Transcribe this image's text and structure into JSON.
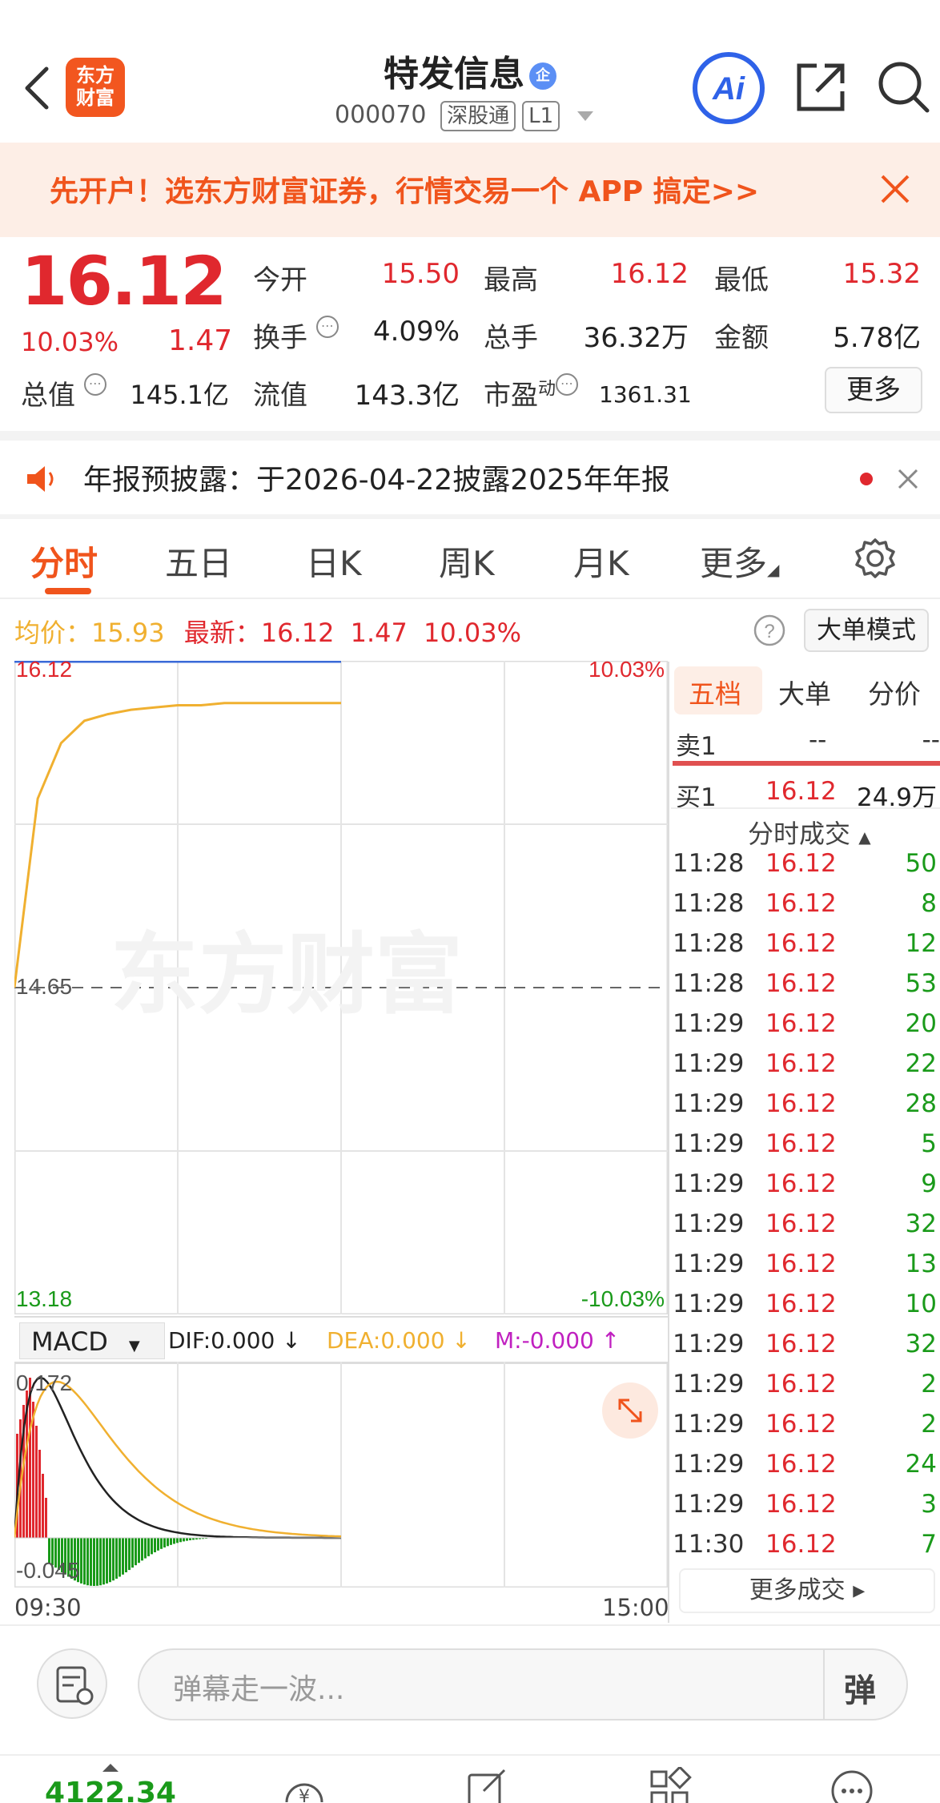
{
  "header": {
    "logo_text_1": "东方",
    "logo_text_2": "财富",
    "stock_name": "特发信息",
    "badge": "企",
    "code": "000070",
    "tag_market": "深股通",
    "tag_level": "L1"
  },
  "banner": {
    "text": "先开户！选东方财富证券，行情交易一个 APP 搞定>>"
  },
  "quote": {
    "price": "16.12",
    "change_pct": "10.03%",
    "change": "1.47",
    "open_label": "今开",
    "open": "15.50",
    "high_label": "最高",
    "high": "16.12",
    "low_label": "最低",
    "low": "15.32",
    "turnover_label": "换手",
    "turnover": "4.09%",
    "volume_label": "总手",
    "volume": "36.32万",
    "amount_label": "金额",
    "amount": "5.78亿",
    "mcap_label": "总值",
    "mcap": "145.1亿",
    "float_label": "流值",
    "float": "143.3亿",
    "pe_label": "市盈",
    "pe_sup": "动",
    "pe": "1361.31",
    "more_label": "更多"
  },
  "announce": {
    "text": "年报预披露：于2026-04-22披露2025年年报"
  },
  "tabs": [
    {
      "label": "分时"
    },
    {
      "label": "五日"
    },
    {
      "label": "日K"
    },
    {
      "label": "周K"
    },
    {
      "label": "月K"
    },
    {
      "label": "更多"
    }
  ],
  "infoline": {
    "avg_label": "均价：",
    "avg": "15.93",
    "latest_label": "最新：",
    "latest": "16.12",
    "change": "1.47",
    "pct": "10.03%",
    "bigorder_label": "大单模式"
  },
  "chart_data": {
    "type": "line",
    "y_top": "16.12",
    "y_mid": "14.65",
    "y_bottom": "13.18",
    "pct_top": "10.03%",
    "pct_bottom": "-10.03%",
    "x_start": "09:30",
    "x_end": "15:00",
    "watermark": "东方财富",
    "ylim": [
      13.18,
      16.12
    ],
    "series": [
      {
        "values": [
          14.65,
          15.5,
          15.75,
          15.85,
          15.88,
          15.9,
          15.91,
          15.92,
          15.92,
          15.93,
          15.93,
          15.93,
          15.93,
          15.93,
          15.93
        ]
      }
    ],
    "price_line": 16.12,
    "macd": {
      "label": "MACD",
      "dif_label": "DIF:0.000",
      "dea_label": "DEA:0.000",
      "m_label": "M:-0.000",
      "y_top": "0.172",
      "y_bottom": "-0.045"
    }
  },
  "order_panel": {
    "tabs": [
      "五档",
      "大单",
      "分价"
    ],
    "sell1_label": "卖1",
    "sell1_price": "--",
    "sell1_vol": "--",
    "buy1_label": "买1",
    "buy1_price": "16.12",
    "buy1_vol": "24.9万",
    "trades_title": "分时成交",
    "trades": [
      {
        "time": "11:28",
        "price": "16.12",
        "vol": "50"
      },
      {
        "time": "11:28",
        "price": "16.12",
        "vol": "8"
      },
      {
        "time": "11:28",
        "price": "16.12",
        "vol": "12"
      },
      {
        "time": "11:28",
        "price": "16.12",
        "vol": "53"
      },
      {
        "time": "11:29",
        "price": "16.12",
        "vol": "20"
      },
      {
        "time": "11:29",
        "price": "16.12",
        "vol": "22"
      },
      {
        "time": "11:29",
        "price": "16.12",
        "vol": "28"
      },
      {
        "time": "11:29",
        "price": "16.12",
        "vol": "5"
      },
      {
        "time": "11:29",
        "price": "16.12",
        "vol": "9"
      },
      {
        "time": "11:29",
        "price": "16.12",
        "vol": "32"
      },
      {
        "time": "11:29",
        "price": "16.12",
        "vol": "13"
      },
      {
        "time": "11:29",
        "price": "16.12",
        "vol": "10"
      },
      {
        "time": "11:29",
        "price": "16.12",
        "vol": "32"
      },
      {
        "time": "11:29",
        "price": "16.12",
        "vol": "2"
      },
      {
        "time": "11:29",
        "price": "16.12",
        "vol": "2"
      },
      {
        "time": "11:29",
        "price": "16.12",
        "vol": "24"
      },
      {
        "time": "11:29",
        "price": "16.12",
        "vol": "3"
      },
      {
        "time": "11:30",
        "price": "16.12",
        "vol": "7"
      }
    ],
    "more_trades": "更多成交"
  },
  "comment": {
    "placeholder": "弹幕走一波...",
    "danmu_label": "弹"
  },
  "bottom_nav": {
    "index_value": "4122.34"
  }
}
